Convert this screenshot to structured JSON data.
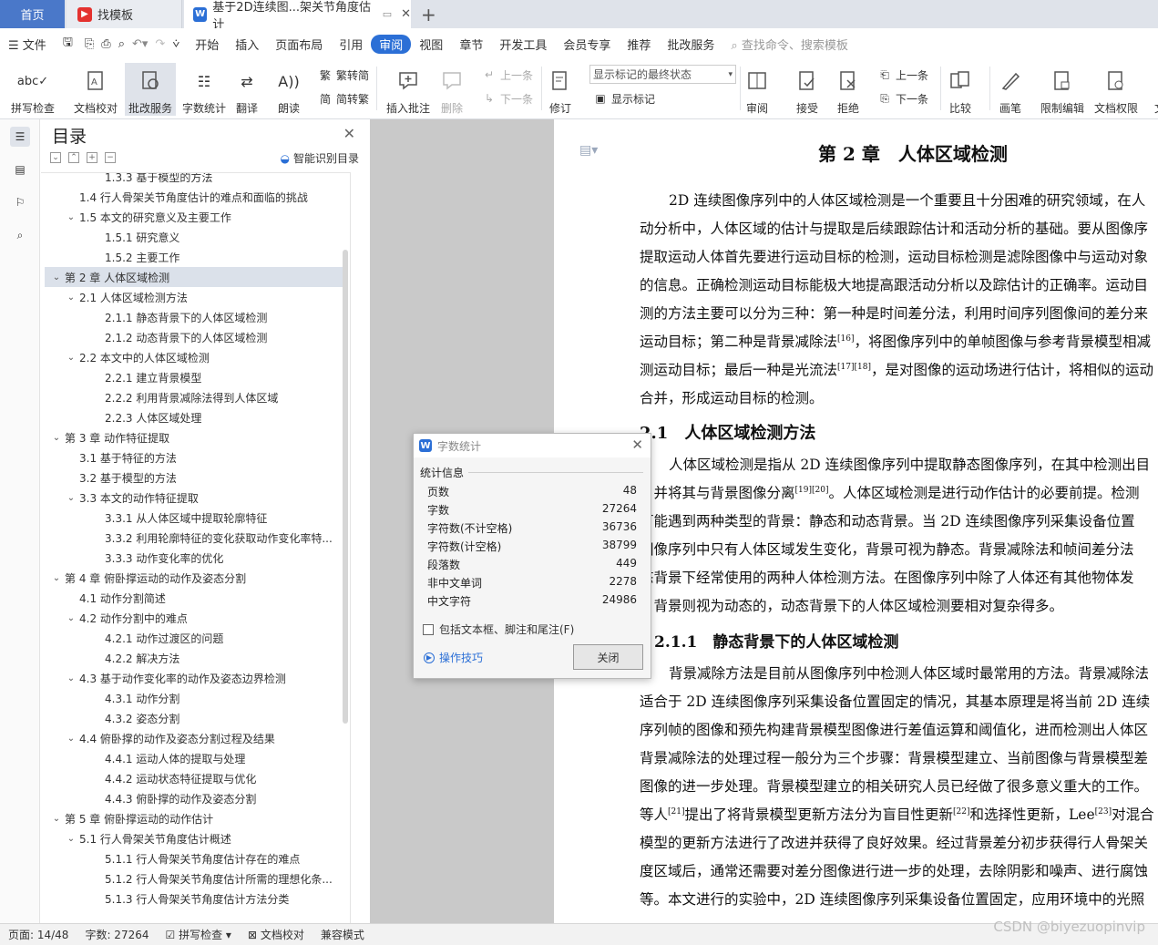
{
  "tabs": {
    "home": "首页",
    "template": "找模板",
    "document": "基于2D连续图...架关节角度估计"
  },
  "menu": {
    "file": "文件",
    "items": [
      "开始",
      "插入",
      "页面布局",
      "引用",
      "审阅",
      "视图",
      "章节",
      "开发工具",
      "会员专享",
      "推荐",
      "批改服务"
    ],
    "search": "查找命令、搜索模板"
  },
  "toolbar": {
    "spellcheck": "拼写检查",
    "doc_check": "文档校对",
    "correction": "批改服务",
    "word_count": "字数统计",
    "translate": "翻译",
    "read_aloud": "朗读",
    "to_trad": "繁转简",
    "to_simp": "简转繁",
    "insert_comment": "插入批注",
    "delete": "删除",
    "prev": "上一条",
    "next": "下一条",
    "revise": "修订",
    "markup_select": "显示标记的最终状态",
    "show_markup": "显示标记",
    "review": "审阅",
    "accept": "接受",
    "reject": "拒绝",
    "prev2": "上一条",
    "next2": "下一条",
    "compare": "比较",
    "pen": "画笔",
    "restrict": "限制编辑",
    "doc_perm": "文档权限",
    "more": "文"
  },
  "outline": {
    "title": "目录",
    "smart": "智能识别目录",
    "items": [
      {
        "text": "1.3.3 基于模型的方法",
        "level": 3
      },
      {
        "text": "1.4 行人骨架关节角度估计的难点和面临的挑战",
        "level": 2
      },
      {
        "text": "1.5 本文的研究意义及主要工作",
        "level": 2,
        "exp": true
      },
      {
        "text": "1.5.1 研究意义",
        "level": 3
      },
      {
        "text": "1.5.2 主要工作",
        "level": 3
      },
      {
        "text": "第 2 章 人体区域检测",
        "level": 1,
        "exp": true,
        "sel": true
      },
      {
        "text": "2.1 人体区域检测方法",
        "level": 2,
        "exp": true
      },
      {
        "text": "2.1.1 静态背景下的人体区域检测",
        "level": 3
      },
      {
        "text": "2.1.2 动态背景下的人体区域检测",
        "level": 3
      },
      {
        "text": "2.2 本文中的人体区域检测",
        "level": 2,
        "exp": true
      },
      {
        "text": "2.2.1 建立背景模型",
        "level": 3
      },
      {
        "text": "2.2.2 利用背景减除法得到人体区域",
        "level": 3
      },
      {
        "text": "2.2.3 人体区域处理",
        "level": 3
      },
      {
        "text": "第 3 章 动作特征提取",
        "level": 1,
        "exp": true
      },
      {
        "text": "3.1 基于特征的方法",
        "level": 2
      },
      {
        "text": "3.2 基于模型的方法",
        "level": 2
      },
      {
        "text": "3.3 本文的动作特征提取",
        "level": 2,
        "exp": true
      },
      {
        "text": "3.3.1 从人体区域中提取轮廓特征",
        "level": 3
      },
      {
        "text": "3.3.2 利用轮廓特征的变化获取动作变化率特...",
        "level": 3
      },
      {
        "text": "3.3.3 动作变化率的优化",
        "level": 3
      },
      {
        "text": "第 4 章 俯卧撑运动的动作及姿态分割",
        "level": 1,
        "exp": true
      },
      {
        "text": "4.1 动作分割简述",
        "level": 2
      },
      {
        "text": "4.2 动作分割中的难点",
        "level": 2,
        "exp": true
      },
      {
        "text": "4.2.1 动作过渡区的问题",
        "level": 3
      },
      {
        "text": "4.2.2 解决方法",
        "level": 3
      },
      {
        "text": "4.3 基于动作变化率的动作及姿态边界检测",
        "level": 2,
        "exp": true
      },
      {
        "text": "4.3.1 动作分割",
        "level": 3
      },
      {
        "text": "4.3.2 姿态分割",
        "level": 3
      },
      {
        "text": "4.4 俯卧撑的动作及姿态分割过程及结果",
        "level": 2,
        "exp": true
      },
      {
        "text": "4.4.1 运动人体的提取与处理",
        "level": 3
      },
      {
        "text": "4.4.2 运动状态特征提取与优化",
        "level": 3
      },
      {
        "text": "4.4.3 俯卧撑的动作及姿态分割",
        "level": 3
      },
      {
        "text": "第 5 章 俯卧撑运动的动作估计",
        "level": 1,
        "exp": true
      },
      {
        "text": "5.1 行人骨架关节角度估计概述",
        "level": 2,
        "exp": true
      },
      {
        "text": "5.1.1 行人骨架关节角度估计存在的难点",
        "level": 3
      },
      {
        "text": "5.1.2 行人骨架关节角度估计所需的理想化条...",
        "level": 3
      },
      {
        "text": "5.1.3 行人骨架关节角度估计方法分类",
        "level": 3
      }
    ]
  },
  "document": {
    "lines": [
      {
        "html": "第 2 章　人体区域检测",
        "cls": "h1"
      },
      {
        "html": "2D 连续图像序列中的人体区域检测是一个重要且十分困难的研究领域，在人"
      },
      {
        "html": "动分析中，人体区域的估计与提取是后续跟踪估计和活动分析的基础。要从图像序"
      },
      {
        "html": "提取运动人体首先要进行运动目标的检测，运动目标检测是滤除图像中与运动对象"
      },
      {
        "html": "的信息。正确检测运动目标能极大地提高跟活动分析以及踪估计的正确率。运动目"
      },
      {
        "html": "测的方法主要可以分为三种：第一种是时间差分法，利用时间序列图像间的差分来"
      },
      {
        "html": "运动目标；第二种是背景减除法<sup>[16]</sup>，将图像序列中的单帧图像与参考背景模型相减"
      },
      {
        "html": "测运动目标；最后一种是光流法<sup>[17][18]</sup>，是对图像的运动场进行估计，将相似的运动"
      },
      {
        "html": "合并，形成运动目标的检测。"
      },
      {
        "html": "2.1　人体区域检测方法",
        "cls": "h2"
      },
      {
        "html": "人体区域检测是指从 2D 连续图像序列中提取静态图像序列，在其中检测出目"
      },
      {
        "html": "，并将其与背景图像分离<sup>[19][20]</sup>。人体区域检测是进行动作估计的必要前提。检测"
      },
      {
        "html": "可能遇到两种类型的背景：静态和动态背景。当 2D 连续图像序列采集设备位置"
      },
      {
        "html": "图像序列中只有人体区域发生变化，背景可视为静态。背景减除法和帧间差分法"
      },
      {
        "html": "态背景下经常使用的两种人体检测方法。在图像序列中除了人体还有其他物体发"
      },
      {
        "html": "，背景则视为动态的，动态背景下的人体区域检测要相对复杂得多。"
      },
      {
        "html": "2.1.1　静态背景下的人体区域检测",
        "cls": "h3"
      },
      {
        "html": "背景减除方法是目前从图像序列中检测人体区域时最常用的方法。背景减除法"
      },
      {
        "html": "适合于 2D 连续图像序列采集设备位置固定的情况，其基本原理是将当前 2D 连续"
      },
      {
        "html": "序列帧的图像和预先构建背景模型图像进行差值运算和阈值化，进而检测出人体区"
      },
      {
        "html": "背景减除法的处理过程一般分为三个步骤：背景模型建立、当前图像与背景模型差"
      },
      {
        "html": "图像的进一步处理。背景模型建立的相关研究人员已经做了很多意义重大的工作。"
      },
      {
        "html": "等人<sup>[21]</sup>提出了将背景模型更新方法分为盲目性更新<sup>[22]</sup>和选择性更新，Lee<sup>[23]</sup>对混合"
      },
      {
        "html": "模型的更新方法进行了改进并获得了良好效果。经过背景差分初步获得行人骨架关"
      },
      {
        "html": "度区域后，通常还需要对差分图像进行进一步的处理，去除阴影和噪声、进行腐蚀"
      },
      {
        "html": "等。本文进行的实验中，2D 连续图像序列采集设备位置固定，应用环境中的光照"
      }
    ]
  },
  "dialog": {
    "title": "字数统计",
    "group": "统计信息",
    "rows": [
      {
        "label": "页数",
        "value": "48"
      },
      {
        "label": "字数",
        "value": "27264"
      },
      {
        "label": "字符数(不计空格)",
        "value": "36736"
      },
      {
        "label": "字符数(计空格)",
        "value": "38799"
      },
      {
        "label": "段落数",
        "value": "449"
      },
      {
        "label": "非中文单词",
        "value": "2278"
      },
      {
        "label": "中文字符",
        "value": "24986"
      }
    ],
    "checkbox": "包括文本框、脚注和尾注(F)",
    "tips": "操作技巧",
    "close": "关闭"
  },
  "status": {
    "page": "页面: 14/48",
    "words": "字数: 27264",
    "spell": "拼写检查",
    "doccheck": "文档校对",
    "compat": "兼容模式"
  },
  "watermark": "CSDN @biyezuopinvip",
  "colors": {
    "accent": "#2b6fd6",
    "home_tab": "#4a78c9",
    "wps_red": "#e4322f"
  }
}
